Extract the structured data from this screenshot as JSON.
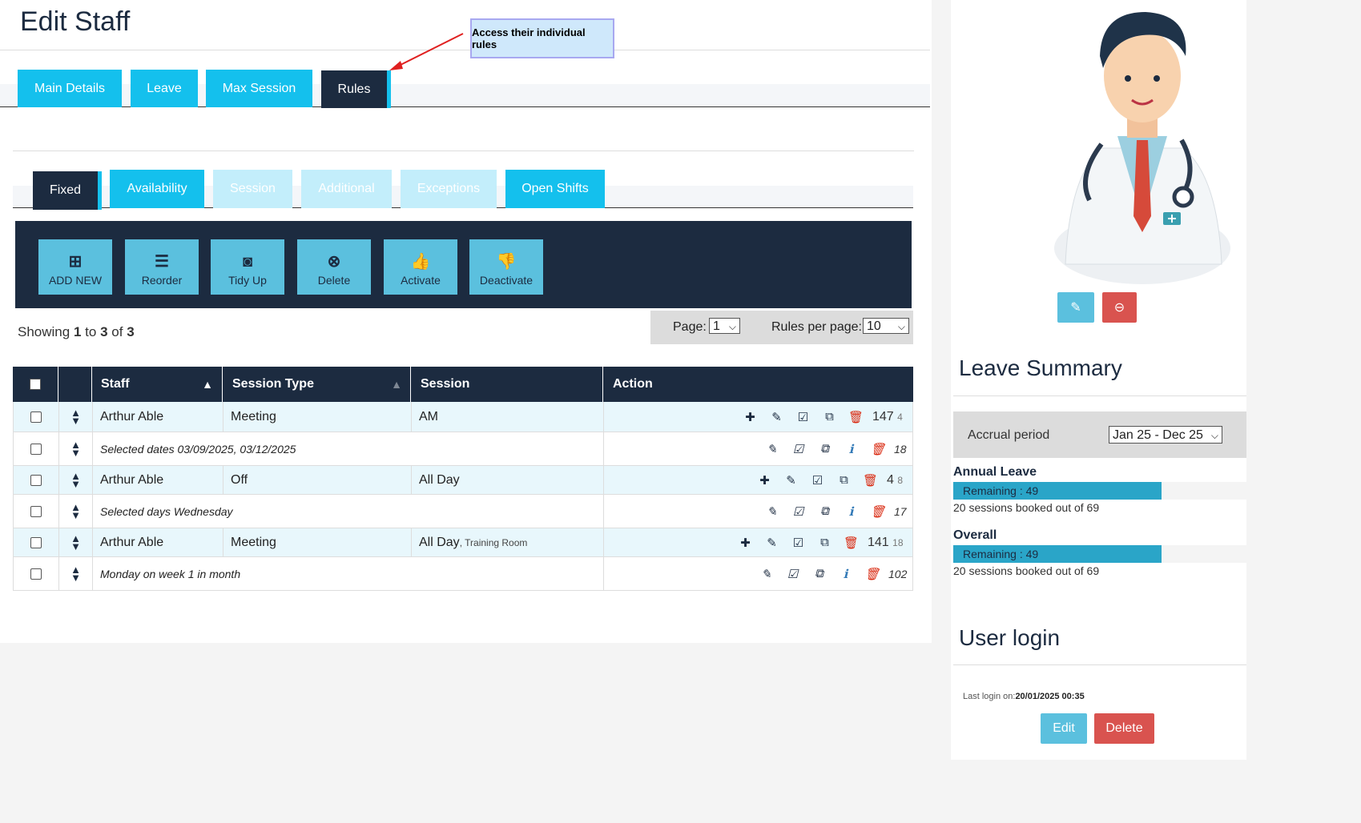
{
  "page_title": "Edit Staff",
  "callout": "Access their individual rules",
  "tabs": [
    "Main Details",
    "Leave",
    "Max Session",
    "Rules"
  ],
  "subtabs": [
    "Fixed",
    "Availability",
    "Session",
    "Additional",
    "Exceptions",
    "Open Shifts"
  ],
  "toolbar": [
    {
      "label": "ADD NEW",
      "icon": "plus-square-icon"
    },
    {
      "label": "Reorder",
      "icon": "bars-icon"
    },
    {
      "label": "Tidy Up",
      "icon": "pocket-icon"
    },
    {
      "label": "Delete",
      "icon": "x-circle-icon"
    },
    {
      "label": "Activate",
      "icon": "thumbs-up-icon"
    },
    {
      "label": "Deactivate",
      "icon": "thumbs-down-icon"
    }
  ],
  "showing": {
    "prefix": "Showing",
    "from": "1",
    "to_word": "to",
    "to": "3",
    "of_word": "of",
    "total": "3"
  },
  "pager": {
    "page_label": "Page:",
    "page_value": "1",
    "per_page_label": "Rules per page:",
    "per_page_value": "10"
  },
  "table": {
    "headers": [
      "Staff",
      "Session Type",
      "Session",
      "Action"
    ],
    "rows": [
      {
        "staff": "Arthur Able",
        "type": "Meeting",
        "session": "AM",
        "session_extra": "",
        "num": "147",
        "sub": "4",
        "detail": "Selected dates 03/09/2025, 03/12/2025",
        "detail_num": "18"
      },
      {
        "staff": "Arthur Able",
        "type": "Off",
        "session": "All Day",
        "session_extra": "",
        "num": "4",
        "sub": "8",
        "detail": "Selected days Wednesday",
        "detail_num": "17"
      },
      {
        "staff": "Arthur Able",
        "type": "Meeting",
        "session": "All Day",
        "session_extra": ", Training Room",
        "num": "141",
        "sub": "18",
        "detail": "Monday on week 1 in month",
        "detail_num": "102"
      }
    ]
  },
  "leave_summary": {
    "title": "Leave Summary",
    "accrual_label": "Accrual period",
    "accrual_value": "Jan 25 - Dec 25",
    "annual": {
      "title": "Annual Leave",
      "remaining": "Remaining : 49",
      "fraction": 0.71,
      "booked": "20 sessions booked out of 69"
    },
    "overall": {
      "title": "Overall",
      "remaining": "Remaining : 49",
      "fraction": 0.71,
      "booked": "20 sessions booked out of 69"
    }
  },
  "user_login": {
    "title": "User login",
    "last_login_label": "Last login on:",
    "last_login_value": "20/01/2025 00:35",
    "edit": "Edit",
    "delete": "Delete"
  },
  "colors": {
    "navy": "#1c2b40",
    "cyan": "#14c0ed",
    "red": "#d9534f",
    "info": "#5bc0de"
  }
}
